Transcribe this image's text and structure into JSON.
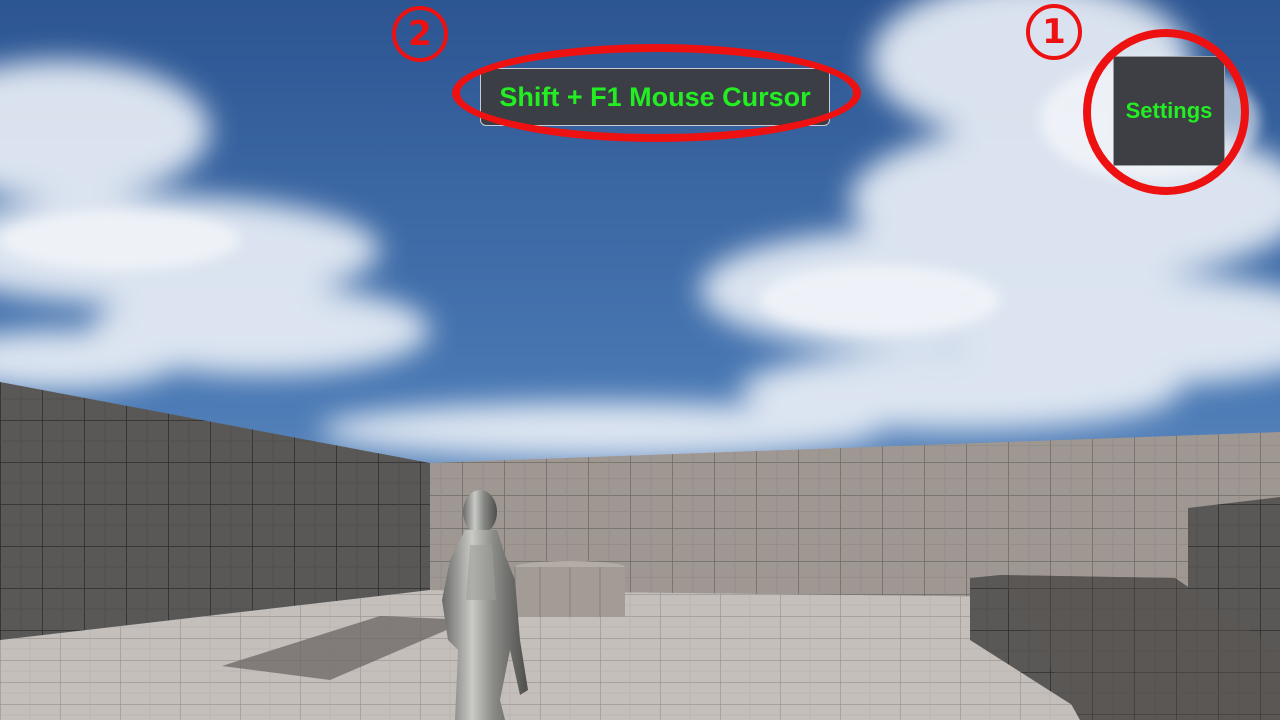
{
  "hud": {
    "cursor_hint_label": "Shift + F1 Mouse Cursor",
    "settings_label": "Settings"
  },
  "annotations": {
    "marker_1": "1",
    "marker_2": "2"
  },
  "colors": {
    "label_text": "#22ee22",
    "annotation_red": "#ee1111",
    "button_bg": "#3b3e45",
    "sky_top": "#2f5a98",
    "floor": "#c9c3bf"
  },
  "icons": {
    "annotation_marker": "circled-number"
  }
}
